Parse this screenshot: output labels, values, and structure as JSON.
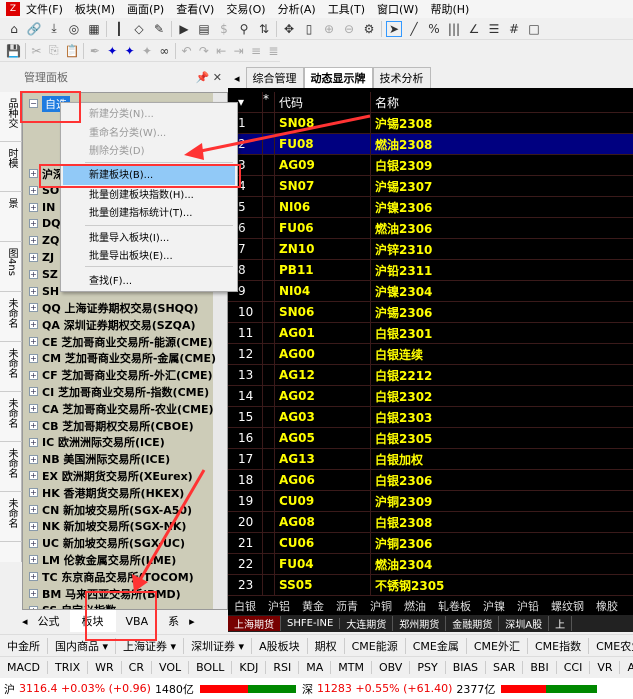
{
  "menu": [
    "文件(F)",
    "板块(M)",
    "画面(P)",
    "查看(V)",
    "交易(O)",
    "分析(A)",
    "工具(T)",
    "窗口(W)",
    "帮助(H)"
  ],
  "panel": {
    "title": "管理面板"
  },
  "vertical_tabs": [
    "TWS多品种交",
    "表日分时模",
    "市场全景",
    "图4ns",
    "未命名",
    "未命名",
    "未命名",
    "未命名",
    "未命名"
  ],
  "tree": {
    "root": "自选",
    "items": [
      "沪深",
      "SO",
      "IN",
      "DQ",
      "ZQ",
      "ZJ",
      "SZ",
      "SH",
      "QQ 上海证券期权交易(SHQQ)",
      "QA 深圳证券期权交易(SZQA)",
      "CE 芝加哥商业交易所-能源(CME)",
      "CM 芝加哥商业交易所-金属(CME)",
      "CF 芝加哥商业交易所-外汇(CME)",
      "CI 芝加哥商业交易所-指数(CME)",
      "CA 芝加哥商业交易所-农业(CME)",
      "CB 芝加哥期权交易所(CBOE)",
      "IC 欧洲洲际交易所(ICE)",
      "NB 美国洲际交易所(ICE)",
      "EX 欧洲期货交易所(XEurex)",
      "HK 香港期货交易所(HKEX)",
      "CN 新加坡交易所(SGX-A50)",
      "NK 新加坡交易所(SGX-NK)",
      "UC 新加坡交易所(SGX-UC)",
      "LM 伦敦金属交易所(LME)",
      "TC 东京商品交易所(TOCOM)",
      "BM 马来西亚交易所(BMD)",
      "SS 自定义指数"
    ]
  },
  "context_menu": [
    {
      "label": "新建分类(N)...",
      "disabled": true
    },
    {
      "label": "重命名分类(W)...",
      "disabled": true
    },
    {
      "label": "删除分类(D)",
      "disabled": true
    },
    {
      "label": "新建板块(B)...",
      "highlighted": true
    },
    {
      "label": "批量创建板块指数(H)..."
    },
    {
      "label": "批量创建指标统计(T)..."
    },
    {
      "label": "批量导入板块(I)..."
    },
    {
      "label": "批量导出板块(E)..."
    },
    {
      "label": "查找(F)..."
    }
  ],
  "left_bottom_tabs": [
    "公式",
    "板块",
    "VBA",
    "系"
  ],
  "right_tabs": [
    "综合管理",
    "动态显示牌",
    "技术分析"
  ],
  "grid": {
    "headers": {
      "star": "*",
      "code": "代码",
      "name": "名称"
    },
    "rows": [
      [
        "SN08",
        "沪锡2308"
      ],
      [
        "FU08",
        "燃油2308"
      ],
      [
        "AG09",
        "白银2309"
      ],
      [
        "SN07",
        "沪锡2307"
      ],
      [
        "NI06",
        "沪镍2306"
      ],
      [
        "FU06",
        "燃油2306"
      ],
      [
        "ZN10",
        "沪锌2310"
      ],
      [
        "PB11",
        "沪铅2311"
      ],
      [
        "NI04",
        "沪镍2304"
      ],
      [
        "SN06",
        "沪锡2306"
      ],
      [
        "AG01",
        "白银2301"
      ],
      [
        "AG00",
        "白银连续"
      ],
      [
        "AG12",
        "白银2212"
      ],
      [
        "AG02",
        "白银2302"
      ],
      [
        "AG03",
        "白银2303"
      ],
      [
        "AG05",
        "白银2305"
      ],
      [
        "AG13",
        "白银加权"
      ],
      [
        "AG06",
        "白银2306"
      ],
      [
        "CU09",
        "沪铜2309"
      ],
      [
        "AG08",
        "白银2308"
      ],
      [
        "CU06",
        "沪铜2306"
      ],
      [
        "FU04",
        "燃油2304"
      ],
      [
        "SS05",
        "不锈钢2305"
      ]
    ],
    "selected_row": 2
  },
  "categories": [
    "白银",
    "沪铝",
    "黄金",
    "沥青",
    "沪铜",
    "燃油",
    "轧卷板",
    "沪镍",
    "沪铅",
    "螺纹钢",
    "橡胶"
  ],
  "exchange_tabs": [
    "上海期货",
    "SHFE-INE",
    "大连期货",
    "郑州期货",
    "金融期货",
    "深圳A股",
    "上"
  ],
  "market_buttons": [
    "中金所",
    "国内商品 ▾",
    "上海证券 ▾",
    "深圳证券 ▾",
    "A股板块",
    "期权",
    "CME能源",
    "CME金属",
    "CME外汇",
    "CME指数",
    "CME农业"
  ],
  "indicator_buttons": [
    "MACD",
    "TRIX",
    "WR",
    "CR",
    "VOL",
    "BOLL",
    "KDJ",
    "RSI",
    "MA",
    "MTM",
    "OBV",
    "PSY",
    "BIAS",
    "SAR",
    "BBI",
    "CCI",
    "VR",
    "ADL"
  ],
  "status": {
    "sh_label": "沪",
    "sh_value": "3116.4 +0.03% (+0.96)",
    "sh_amount": "1480亿",
    "sz_label": "深",
    "sz_value": "11283 +0.55% (+61.40)",
    "sz_amount": "2377亿"
  },
  "colors": {
    "up": "#e00000",
    "down": "#008000",
    "selected": "#000080",
    "highlight": "#91c9f7",
    "annotation": "#ff3333"
  }
}
